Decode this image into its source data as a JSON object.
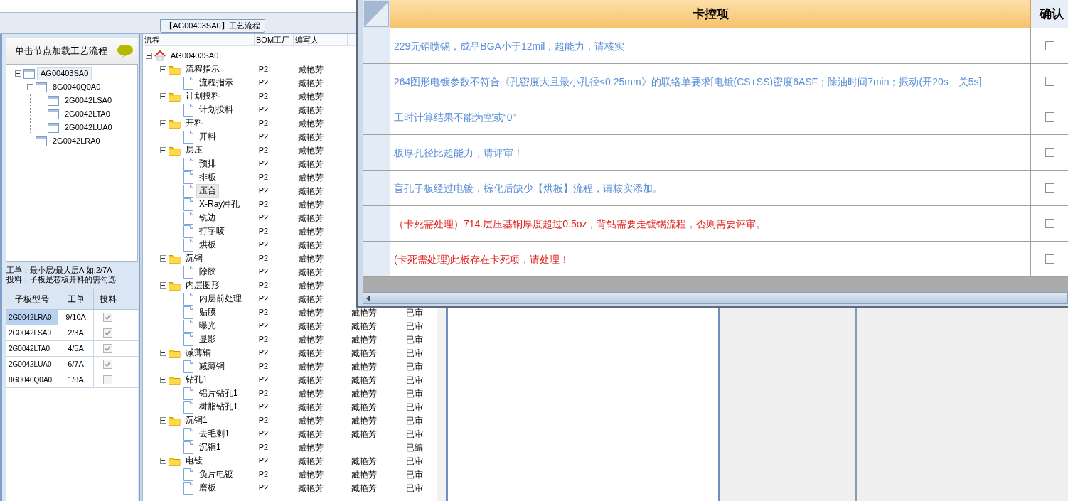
{
  "tab_title": "【AG00403SA0】工艺流程",
  "left_panel": {
    "hint": "单击节点加载工艺流程",
    "tree": [
      {
        "label": "AG00403SA0",
        "selected": true,
        "expanded": true,
        "children": [
          {
            "label": "8G0040Q0A0",
            "selected": false,
            "expanded": true,
            "children": [
              {
                "label": "2G0042LSA0",
                "selected": false
              },
              {
                "label": "2G0042LTA0",
                "selected": false
              },
              {
                "label": "2G0042LUA0",
                "selected": false
              }
            ]
          },
          {
            "label": "2G0042LRA0",
            "selected": false
          }
        ]
      }
    ],
    "note_lines": [
      "工单：最小层/最大层A 如:2/7A",
      "投料：子板是芯板开料的需勾选"
    ],
    "table": {
      "columns": [
        "子板型号",
        "工单",
        "投料"
      ],
      "rows": [
        {
          "model": "2G0042LRA0",
          "order": "9/10A",
          "checked": true,
          "selected": true
        },
        {
          "model": "2G0042LSA0",
          "order": "2/3A",
          "checked": true,
          "selected": false
        },
        {
          "model": "2G0042LTA0",
          "order": "4/5A",
          "checked": true,
          "selected": false
        },
        {
          "model": "2G0042LUA0",
          "order": "6/7A",
          "checked": true,
          "selected": false
        },
        {
          "model": "8G0040Q0A0",
          "order": "1/8A",
          "checked": false,
          "selected": false
        }
      ]
    }
  },
  "flow": {
    "columns": [
      "流程",
      "BOM工厂",
      "编写人"
    ],
    "tree": [
      {
        "label": "AG00403SA0",
        "kind": "root",
        "selected": false,
        "expanded": true,
        "children": [
          {
            "label": "流程指示",
            "kind": "folder",
            "selected": false,
            "expanded": true,
            "bom": "P2",
            "writer": "臧艳芳",
            "children": [
              {
                "label": "流程指示",
                "kind": "step",
                "selected": false,
                "bom": "P2",
                "writer": "臧艳芳"
              }
            ]
          },
          {
            "label": "计划投料",
            "kind": "folder",
            "selected": false,
            "expanded": true,
            "bom": "P2",
            "writer": "臧艳芳",
            "children": [
              {
                "label": "计划投料",
                "kind": "step",
                "selected": false,
                "bom": "P2",
                "writer": "臧艳芳"
              }
            ]
          },
          {
            "label": "开料",
            "kind": "folder",
            "selected": false,
            "expanded": true,
            "bom": "P2",
            "writer": "臧艳芳",
            "children": [
              {
                "label": "开料",
                "kind": "step",
                "selected": false,
                "bom": "P2",
                "writer": "臧艳芳"
              }
            ]
          },
          {
            "label": "层压",
            "kind": "folder",
            "selected": false,
            "expanded": true,
            "bom": "P2",
            "writer": "臧艳芳",
            "children": [
              {
                "label": "预排",
                "kind": "step",
                "selected": false,
                "bom": "P2",
                "writer": "臧艳芳"
              },
              {
                "label": "排板",
                "kind": "step",
                "selected": false,
                "bom": "P2",
                "writer": "臧艳芳"
              },
              {
                "label": "压合",
                "kind": "step",
                "selected": true,
                "bom": "P2",
                "writer": "臧艳芳"
              },
              {
                "label": "X-Ray冲孔",
                "kind": "step",
                "selected": false,
                "bom": "P2",
                "writer": "臧艳芳"
              },
              {
                "label": "铣边",
                "kind": "step",
                "selected": false,
                "bom": "P2",
                "writer": "臧艳芳"
              },
              {
                "label": "打字唛",
                "kind": "step",
                "selected": false,
                "bom": "P2",
                "writer": "臧艳芳"
              },
              {
                "label": "烘板",
                "kind": "step",
                "selected": false,
                "bom": "P2",
                "writer": "臧艳芳"
              }
            ]
          },
          {
            "label": "沉铜",
            "kind": "folder",
            "selected": false,
            "expanded": true,
            "bom": "P2",
            "writer": "臧艳芳",
            "children": [
              {
                "label": "除胶",
                "kind": "step",
                "selected": false,
                "bom": "P2",
                "writer": "臧艳芳"
              }
            ]
          },
          {
            "label": "内层图形",
            "kind": "folder",
            "selected": false,
            "expanded": true,
            "bom": "P2",
            "writer": "臧艳芳",
            "children": [
              {
                "label": "内层前处理",
                "kind": "step",
                "selected": false,
                "bom": "P2",
                "writer": "臧艳芳"
              },
              {
                "label": "贴膜",
                "kind": "step",
                "selected": false,
                "bom": "P2",
                "writer": "臧艳芳",
                "column_4": "臧艳芳",
                "column_5": "已审"
              },
              {
                "label": "曝光",
                "kind": "step",
                "selected": false,
                "bom": "P2",
                "writer": "臧艳芳",
                "column_4": "臧艳芳",
                "column_5": "已审"
              },
              {
                "label": "显影",
                "kind": "step",
                "selected": false,
                "bom": "P2",
                "writer": "臧艳芳",
                "column_4": "臧艳芳",
                "column_5": "已审"
              }
            ]
          },
          {
            "label": "减薄铜",
            "kind": "folder",
            "selected": false,
            "expanded": true,
            "bom": "P2",
            "writer": "臧艳芳",
            "column_4": "臧艳芳",
            "column_5": "已审",
            "children": [
              {
                "label": "减薄铜",
                "kind": "step",
                "selected": false,
                "bom": "P2",
                "writer": "臧艳芳",
                "column_4": "臧艳芳",
                "column_5": "已审"
              }
            ]
          },
          {
            "label": "钻孔1",
            "kind": "folder",
            "selected": false,
            "expanded": true,
            "bom": "P2",
            "writer": "臧艳芳",
            "column_4": "臧艳芳",
            "column_5": "已审",
            "children": [
              {
                "label": "铝片钻孔1",
                "kind": "step",
                "selected": false,
                "bom": "P2",
                "writer": "臧艳芳",
                "column_4": "臧艳芳",
                "column_5": "已审"
              },
              {
                "label": "树脂钻孔1",
                "kind": "step",
                "selected": false,
                "bom": "P2",
                "writer": "臧艳芳",
                "column_4": "臧艳芳",
                "column_5": "已审"
              }
            ]
          },
          {
            "label": "沉铜1",
            "kind": "folder",
            "selected": false,
            "expanded": true,
            "bom": "P2",
            "writer": "臧艳芳",
            "column_4": "臧艳芳",
            "column_5": "已审",
            "children": [
              {
                "label": "去毛刺1",
                "kind": "step",
                "selected": false,
                "bom": "P2",
                "writer": "臧艳芳",
                "column_4": "臧艳芳",
                "column_5": "已审"
              },
              {
                "label": "沉铜1",
                "kind": "step",
                "selected": false,
                "bom": "P2",
                "writer": "臧艳芳",
                "column_5": "已编"
              }
            ]
          },
          {
            "label": "电镀",
            "kind": "folder",
            "selected": false,
            "expanded": true,
            "bom": "P2",
            "writer": "臧艳芳",
            "column_4": "臧艳芳",
            "column_5": "已审",
            "children": [
              {
                "label": "负片电镀",
                "kind": "step",
                "selected": false,
                "bom": "P2",
                "writer": "臧艳芳",
                "column_4": "臧艳芳",
                "column_5": "已审"
              },
              {
                "label": "磨板",
                "kind": "step",
                "selected": false,
                "bom": "P2",
                "writer": "臧艳芳",
                "column_4": "臧艳芳",
                "column_5": "已审"
              }
            ]
          }
        ]
      }
    ]
  },
  "dialog": {
    "header": "卡控项",
    "confirm_header": "确认",
    "rows": [
      {
        "text": "229无铅喷锡，成品BGA小于12mil，超能力，请核实",
        "color": "#5b8fd8",
        "checked": false
      },
      {
        "text": "264图形电镀参数不符合《孔密度大且最小孔径≤0.25mm》的联络单要求[电镀(CS+SS)密度6ASF；除油时间7min；振动(开20s、关5s]",
        "color": "#5b8fd8",
        "checked": false
      },
      {
        "text": "工时计算结果不能为空或“0”",
        "color": "#5b8fd8",
        "checked": false
      },
      {
        "text": "板厚孔径比超能力，请评审！",
        "color": "#5b8fd8",
        "checked": false
      },
      {
        "text": "盲孔子板经过电镀，棕化后缺少【烘板】流程，请核实添加。",
        "color": "#5b8fd8",
        "checked": false
      },
      {
        "text": "（卡死需处理）714.层压基铜厚度超过0.5oz，背钻需要走镀锡流程，否则需要评审。",
        "color": "#e0201a",
        "checked": false
      },
      {
        "text": "(卡死需处理)此板存在卡死项，请处理！",
        "color": "#e0201a",
        "checked": false
      }
    ]
  }
}
